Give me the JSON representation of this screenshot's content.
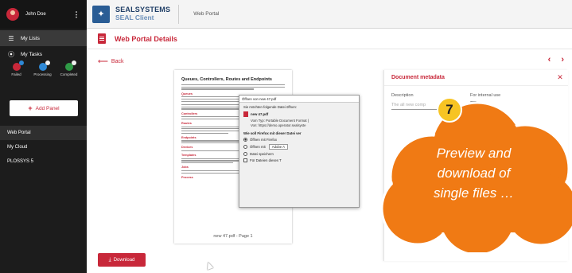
{
  "sidebar": {
    "user_name": "John Doe",
    "my_lists": "My Lists",
    "my_tasks": "My Tasks",
    "tasks": [
      {
        "label": "Failed",
        "color": "#c8283a",
        "sub_color": "#2f89d6"
      },
      {
        "label": "Processing",
        "color": "#2f89d6",
        "sub_color": "#f0f0f0"
      },
      {
        "label": "Completed",
        "color": "#2f9a46",
        "sub_color": "#f0f0f0"
      }
    ],
    "add_panel": "Add Panel",
    "links": [
      "Web Portal",
      "My Cloud",
      "PLOSSYS 5"
    ],
    "active_link": "Web Portal"
  },
  "header": {
    "brand_top": "SEALSYSTEMS",
    "brand_bottom": "SEAL Client",
    "title": "Web Portal"
  },
  "page": {
    "title": "Web Portal Details",
    "back": "Back",
    "prev_icon": "chevron-left-icon",
    "next_icon": "chevron-right-icon"
  },
  "preview": {
    "doc_title": "Queues, Controllers, Routes and Endpoints",
    "headings": [
      "Queues",
      "Controllers",
      "Routes",
      "Endpoints",
      "Devices",
      "Templates",
      "Jobs",
      "Process"
    ],
    "caption": "new 47.pdf - Page 1"
  },
  "download": {
    "label": "Download"
  },
  "metadata": {
    "title": "Document metadata",
    "description_label": "Description",
    "description_placeholder": "The all new comp",
    "internal_label": "For internal use"
  },
  "dialog": {
    "title": "Öffnen von new 47.pdf",
    "intro": "Sie möchten folgende Datei öffnen:",
    "file_name": "new 47.pdf",
    "file_type": "Vom Typ: Portable Document Format (",
    "file_source": "Von: https://demo.operator.sealsyste",
    "question": "Wie soll Firefox mit dieser Datei ver",
    "options": [
      {
        "label": "Öffnen mit Firefox",
        "selected": true
      },
      {
        "label": "Öffnen mit",
        "selected": false
      },
      {
        "label": "Datei speichern",
        "selected": false
      }
    ],
    "open_with_app": "Adobe A",
    "remember": "Für Dateien dieses T"
  },
  "callout": {
    "step": "7",
    "lines": [
      "Preview and",
      "download of",
      "single files …"
    ],
    "color": "#f07a14"
  }
}
